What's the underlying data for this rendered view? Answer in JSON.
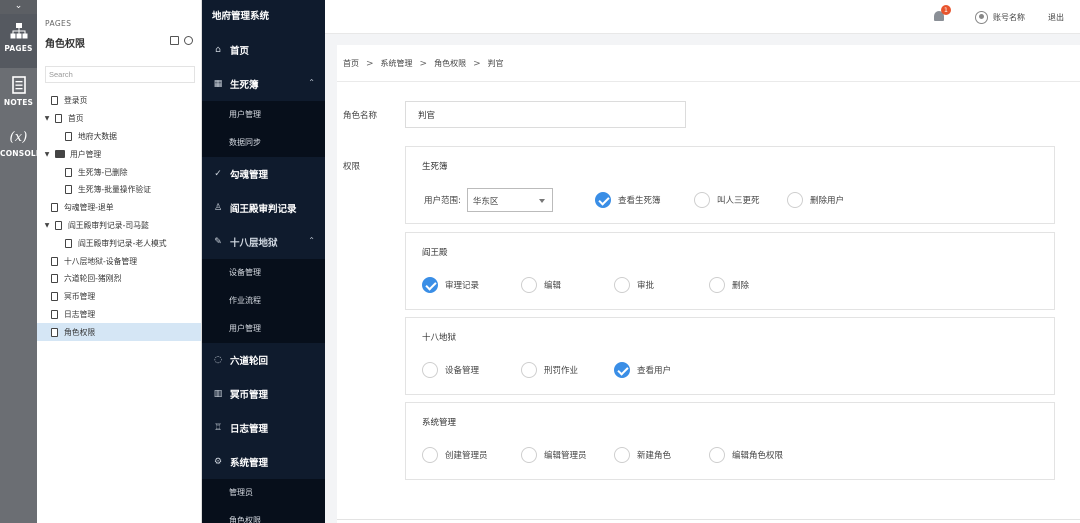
{
  "rail": {
    "tools": [
      {
        "label": "PAGES",
        "icon": "sitemap-icon"
      },
      {
        "label": "NOTES",
        "icon": "notes-icon"
      },
      {
        "label": "CONSOLE",
        "icon": "variable-icon",
        "glyph": "(x)"
      }
    ]
  },
  "pages_panel": {
    "title": "PAGES",
    "current": "角色权限",
    "search_placeholder": "Search",
    "tree": [
      {
        "label": "登录页",
        "level": 1,
        "type": "file",
        "caret": ""
      },
      {
        "label": "首页",
        "level": 0,
        "type": "file",
        "caret": "▼"
      },
      {
        "label": "地府大数据",
        "level": 2,
        "type": "file",
        "caret": ""
      },
      {
        "label": "用户管理",
        "level": 0,
        "type": "folder",
        "caret": "▼"
      },
      {
        "label": "生死簿-已删除",
        "level": 2,
        "type": "file",
        "caret": ""
      },
      {
        "label": "生死簿-批量操作验证",
        "level": 2,
        "type": "file",
        "caret": ""
      },
      {
        "label": "勾魂管理-退单",
        "level": 1,
        "type": "file",
        "caret": ""
      },
      {
        "label": "阎王殿审判记录-司马懿",
        "level": 0,
        "type": "file",
        "caret": "▼"
      },
      {
        "label": "阎王殿审判记录-老人模式",
        "level": 2,
        "type": "file",
        "caret": ""
      },
      {
        "label": "十八层地狱-设备管理",
        "level": 1,
        "type": "file",
        "caret": ""
      },
      {
        "label": "六道轮回-猪刚烈",
        "level": 1,
        "type": "file",
        "caret": ""
      },
      {
        "label": "冥币管理",
        "level": 1,
        "type": "file",
        "caret": ""
      },
      {
        "label": "日志管理",
        "level": 1,
        "type": "file",
        "caret": ""
      },
      {
        "label": "角色权限",
        "level": 1,
        "type": "file",
        "caret": "",
        "selected": true
      }
    ]
  },
  "sidebar": {
    "brand": "地府管理系统",
    "menu": [
      {
        "label": "首页",
        "icon": "⌂",
        "arrow": ""
      },
      {
        "label": "生死簿",
        "icon": "▦",
        "arrow": "⌃",
        "sub": [
          "用户管理",
          "数据同步"
        ]
      },
      {
        "label": "勾魂管理",
        "icon": "✓",
        "arrow": ""
      },
      {
        "label": "阎王殿审判记录",
        "icon": "♙",
        "arrow": ""
      },
      {
        "label": "十八层地狱",
        "icon": "✎",
        "arrow": "⌃",
        "dim": true,
        "sub": [
          "设备管理",
          "作业流程",
          "用户管理"
        ]
      },
      {
        "label": "六道轮回",
        "icon": "◌",
        "arrow": ""
      },
      {
        "label": "冥币管理",
        "icon": "▥",
        "arrow": ""
      },
      {
        "label": "日志管理",
        "icon": "♖",
        "arrow": ""
      },
      {
        "label": "系统管理",
        "icon": "⚙",
        "arrow": "",
        "sub": [
          "管理员",
          "角色权限"
        ]
      }
    ]
  },
  "header": {
    "notification_count": "1",
    "account": "账号名称",
    "logout": "退出"
  },
  "breadcrumb": [
    "首页",
    "系统管理",
    "角色权限",
    "判官"
  ],
  "form": {
    "role_label": "角色名称",
    "role_value": "判官",
    "perm_label": "权限",
    "groups": [
      {
        "title": "生死簿",
        "scope_label": "用户范围:",
        "scope_value": "华东区",
        "options": [
          {
            "label": "查看生死簿",
            "checked": true
          },
          {
            "label": "叫人三更死",
            "checked": false
          },
          {
            "label": "删除用户",
            "checked": false
          }
        ]
      },
      {
        "title": "阎王殿",
        "options": [
          {
            "label": "审理记录",
            "checked": true
          },
          {
            "label": "编辑",
            "checked": false
          },
          {
            "label": "审批",
            "checked": false
          },
          {
            "label": "删除",
            "checked": false
          }
        ]
      },
      {
        "title": "十八地狱",
        "options": [
          {
            "label": "设备管理",
            "checked": false
          },
          {
            "label": "刑罚作业",
            "checked": false
          },
          {
            "label": "查看用户",
            "checked": true
          }
        ]
      },
      {
        "title": "系统管理",
        "options": [
          {
            "label": "创建管理员",
            "checked": false
          },
          {
            "label": "编辑管理员",
            "checked": false
          },
          {
            "label": "新建角色",
            "checked": false
          },
          {
            "label": "编辑角色权限",
            "checked": false
          }
        ]
      }
    ]
  },
  "colors": {
    "accent": "#3a8ee6",
    "sidebar_bg": "#0f1b2d",
    "badge": "#e8542d"
  }
}
